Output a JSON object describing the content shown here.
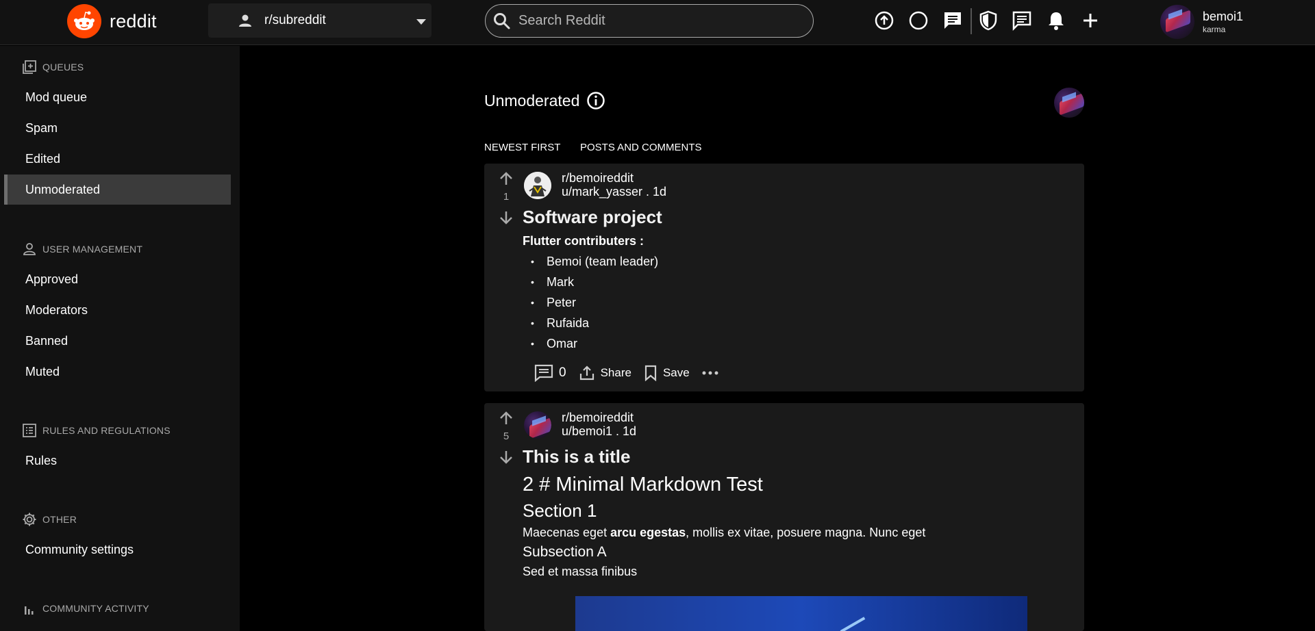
{
  "topbar": {
    "logo_text": "reddit",
    "subreddit_select": "r/subreddit",
    "search_placeholder": "Search Reddit",
    "tools": [
      "upload-icon",
      "circle-icon",
      "chat-icon",
      "shield-icon",
      "message-icon",
      "bell-icon",
      "plus-icon"
    ],
    "user": {
      "name": "bemoi1",
      "karma_label": "karma"
    }
  },
  "sidebar": {
    "sections": [
      {
        "title": "QUEUES",
        "icon": "queue-icon",
        "items": [
          "Mod queue",
          "Spam",
          "Edited",
          "Unmoderated"
        ]
      },
      {
        "title": "USER MANAGEMENT",
        "icon": "person-icon",
        "items": [
          "Approved",
          "Moderators",
          "Banned",
          "Muted"
        ]
      },
      {
        "title": "RULES AND REGULATIONS",
        "icon": "list-icon",
        "items": [
          "Rules"
        ]
      },
      {
        "title": "OTHER",
        "icon": "gear-icon",
        "items": [
          "Community settings"
        ]
      },
      {
        "title": "COMMUNITY ACTIVITY",
        "icon": "bar-chart-icon",
        "items": []
      }
    ],
    "active_item": "Unmoderated"
  },
  "main": {
    "heading": "Unmoderated",
    "sort": {
      "order": "NEWEST FIRST",
      "type": "POSTS AND COMMENTS"
    },
    "posts": [
      {
        "votes": "1",
        "subreddit": "r/bemoireddit",
        "author_line": "u/mark_yasser . 1d",
        "title": "Software project",
        "body_heading": "Flutter contributers :",
        "bullets": [
          "Bemoi (team leader)",
          "Mark",
          "Peter",
          "Rufaida",
          "Omar"
        ],
        "comments": "0",
        "share_label": "Share",
        "save_label": "Save"
      },
      {
        "votes": "5",
        "subreddit": "r/bemoireddit",
        "author_line": "u/bemoi1 . 1d",
        "title": "This is a title",
        "md_h1": "2 # Minimal Markdown Test",
        "md_h2": "Section 1",
        "md_p1_pre": "Maecenas eget ",
        "md_p1_bold": "arcu egestas",
        "md_p1_post": ", mollis ex vitae, posuere magna. Nunc eget",
        "md_h3": "Subsection A",
        "md_p2": "Sed et massa finibus"
      }
    ]
  },
  "colors": {
    "brand": "#ff4500",
    "background": "#000000",
    "panel": "#121212",
    "card": "#1a1a1a"
  }
}
